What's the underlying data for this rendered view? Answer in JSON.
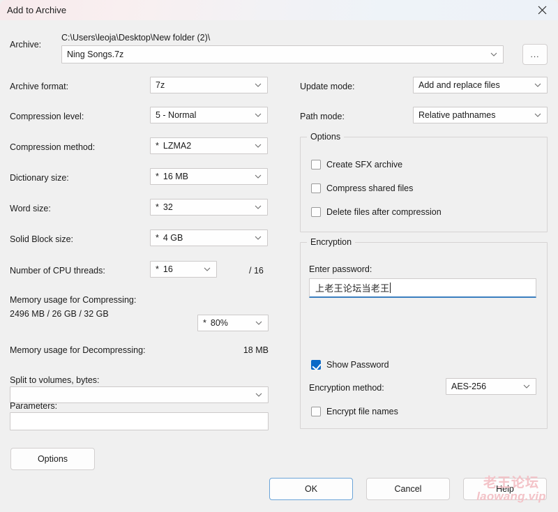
{
  "window": {
    "title": "Add to Archive",
    "close_icon": "close-icon"
  },
  "archive": {
    "label": "Archive:",
    "path": "C:\\Users\\leoja\\Desktop\\New folder (2)\\",
    "name": "Ning Songs.7z",
    "browse_label": "..."
  },
  "left": {
    "archive_format": {
      "label": "Archive format:",
      "value": "7z",
      "star": ""
    },
    "compression_level": {
      "label": "Compression level:",
      "value": "5 - Normal",
      "star": ""
    },
    "compression_method": {
      "label": "Compression method:",
      "value": "LZMA2",
      "star": "*"
    },
    "dictionary_size": {
      "label": "Dictionary size:",
      "value": "16 MB",
      "star": "*"
    },
    "word_size": {
      "label": "Word size:",
      "value": "32",
      "star": "*"
    },
    "solid_block_size": {
      "label": "Solid Block size:",
      "value": "4 GB",
      "star": "*"
    },
    "cpu_threads": {
      "label": "Number of CPU threads:",
      "value": "16",
      "star": "*",
      "max": "/ 16"
    },
    "mem_compress": {
      "label": "Memory usage for Compressing:",
      "value": "2496 MB / 26 GB / 32 GB",
      "percent": "80%",
      "star": "*"
    },
    "mem_decompress": {
      "label": "Memory usage for Decompressing:",
      "value": "18 MB"
    },
    "split": {
      "label": "Split to volumes, bytes:",
      "value": ""
    },
    "parameters": {
      "label": "Parameters:",
      "value": ""
    }
  },
  "right": {
    "update_mode": {
      "label": "Update mode:",
      "value": "Add and replace files"
    },
    "path_mode": {
      "label": "Path mode:",
      "value": "Relative pathnames"
    },
    "options": {
      "title": "Options",
      "items": [
        {
          "label": "Create SFX archive",
          "checked": false
        },
        {
          "label": "Compress shared files",
          "checked": false
        },
        {
          "label": "Delete files after compression",
          "checked": false
        }
      ]
    },
    "encryption": {
      "title": "Encryption",
      "password_label": "Enter password:",
      "password_value": "上老王论坛当老王",
      "show_password": {
        "label": "Show Password",
        "checked": true
      },
      "method_label": "Encryption method:",
      "method_value": "AES-256",
      "encrypt_names": {
        "label": "Encrypt file names",
        "checked": false
      }
    }
  },
  "footer": {
    "options_label": "Options",
    "ok_label": "OK",
    "cancel_label": "Cancel",
    "help_label": "Help"
  },
  "watermark": {
    "line1": "老王论坛",
    "line2": "laowang.vip",
    "color": "#f3c3c8"
  },
  "colors": {
    "accent": "#0b69c7",
    "focus_border": "#6ba4d8",
    "dialog_bg": "#f0f0f0",
    "field_bg": "#ffffff"
  }
}
